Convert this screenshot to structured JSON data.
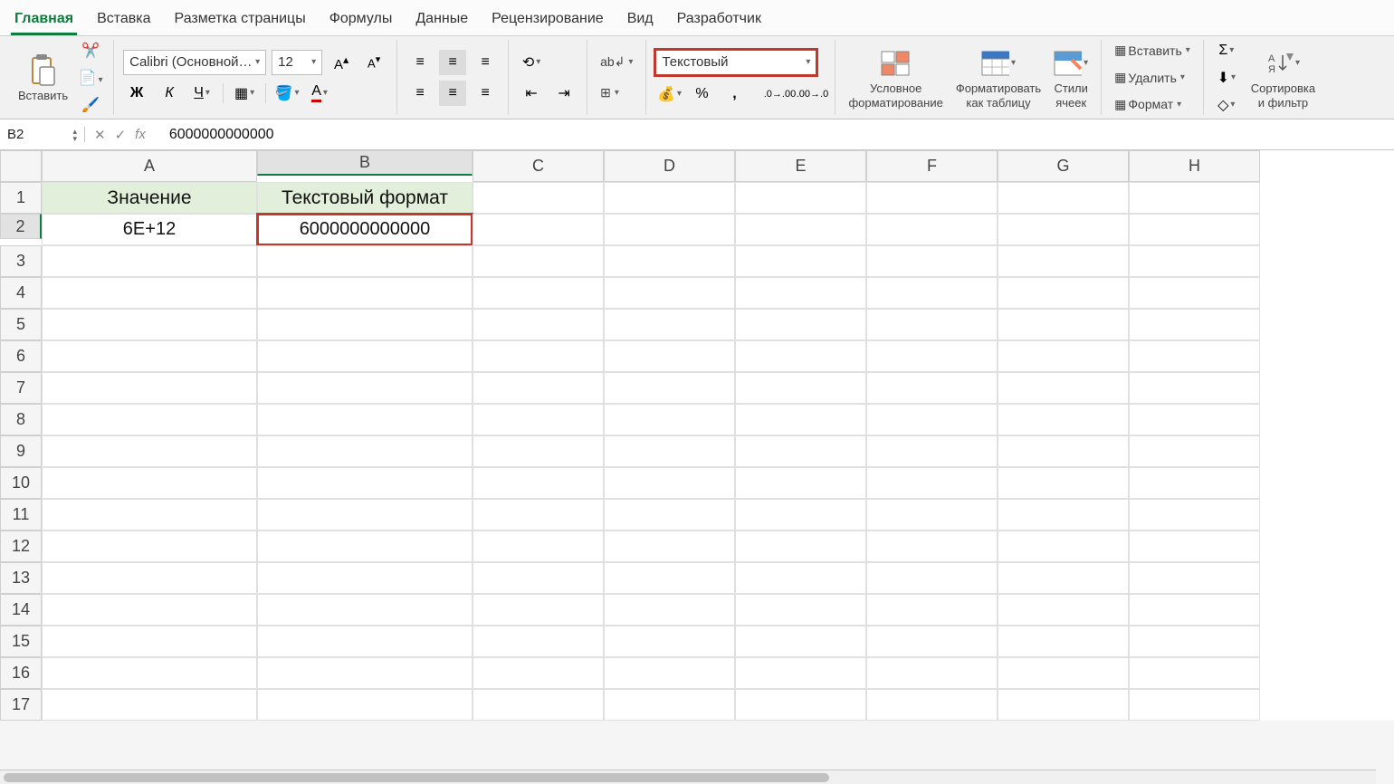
{
  "tabs": [
    {
      "label": "Главная",
      "active": true
    },
    {
      "label": "Вставка"
    },
    {
      "label": "Разметка страницы"
    },
    {
      "label": "Формулы"
    },
    {
      "label": "Данные"
    },
    {
      "label": "Рецензирование"
    },
    {
      "label": "Вид"
    },
    {
      "label": "Разработчик"
    }
  ],
  "clipboard": {
    "paste": "Вставить"
  },
  "font": {
    "name": "Calibri (Основной…",
    "size": "12"
  },
  "number": {
    "format": "Текстовый"
  },
  "styles": {
    "cond1": "Условное",
    "cond2": "форматирование",
    "table1": "Форматировать",
    "table2": "как таблицу",
    "cell1": "Стили",
    "cell2": "ячеек"
  },
  "cells": {
    "insert": "Вставить",
    "delete": "Удалить",
    "format": "Формат"
  },
  "editing": {
    "sort1": "Сортировка",
    "sort2": "и фильтр"
  },
  "fbar": {
    "name": "B2",
    "formula": "6000000000000"
  },
  "columns": [
    "A",
    "B",
    "C",
    "D",
    "E",
    "F",
    "G",
    "H"
  ],
  "rows": [
    "1",
    "2",
    "3",
    "4",
    "5",
    "6",
    "7",
    "8",
    "9",
    "10",
    "11",
    "12",
    "13",
    "14",
    "15",
    "16",
    "17"
  ],
  "data": {
    "A1": "Значение",
    "B1": "Текстовый формат",
    "A2": "6E+12",
    "B2": "6000000000000"
  },
  "active_cell": "B2",
  "selected_col": "B",
  "selected_row": "2"
}
